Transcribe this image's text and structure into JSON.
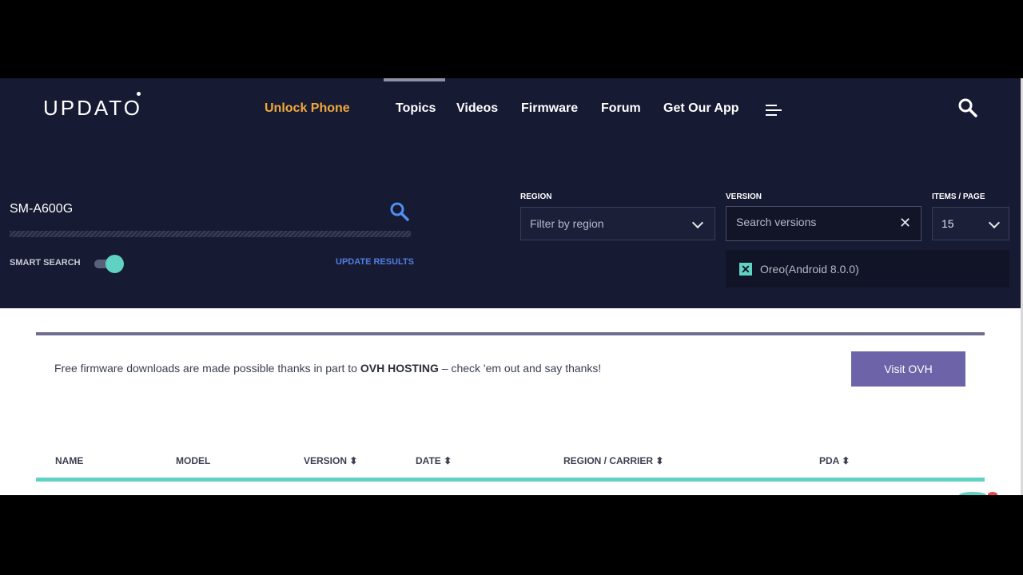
{
  "header": {
    "logo": "UPDATO",
    "nav": [
      "Unlock Phone",
      "Topics",
      "Videos",
      "Firmware",
      "Forum",
      "Get Our App"
    ],
    "menu_icon": "hamburger-menu-icon",
    "search_icon": "search-icon"
  },
  "search": {
    "query": "SM-A600G",
    "smart_search_label": "SMART SEARCH",
    "smart_search_on": true,
    "update_results": "UPDATE RESULTS"
  },
  "filters": {
    "region_label": "REGION",
    "region_value": "Filter by region",
    "version_label": "VERSION",
    "version_placeholder": "Search versions",
    "items_label": "ITEMS / PAGE",
    "items_value": "15",
    "selected_version": "Oreo(Android 8.0.0)"
  },
  "promo": {
    "text_before": "Free firmware downloads are made possible thanks in part to ",
    "sponsor": "OVH HOSTING",
    "text_after": " – check 'em out and say thanks!",
    "button": "Visit OVH"
  },
  "table": {
    "columns": [
      "NAME",
      "MODEL",
      "VERSION",
      "DATE",
      "REGION / CARRIER",
      "PDA"
    ]
  },
  "colors": {
    "header_bg": "#171a33",
    "accent_orange": "#f2a93b",
    "teal": "#5fd2c3",
    "link_blue": "#4f7fe0",
    "button_purple": "#6d63a8"
  }
}
